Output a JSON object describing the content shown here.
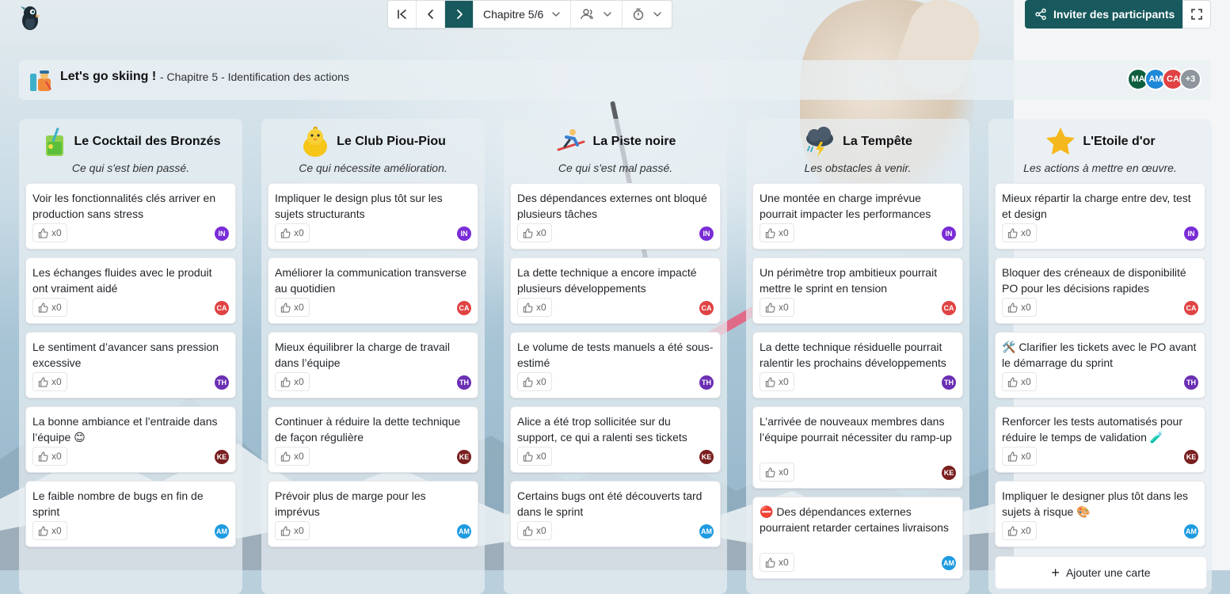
{
  "toolbar": {
    "chapter_label": "Chapitre 5/6"
  },
  "invite_label": "Inviter des participants",
  "header": {
    "title": "Let's go skiing !",
    "subtitle": "- Chapitre 5 - Identification des actions"
  },
  "participants": [
    {
      "initials": "MA",
      "color": "#0f5f3f"
    },
    {
      "initials": "AM",
      "color": "#1e88d8"
    },
    {
      "initials": "CA",
      "color": "#e04343"
    },
    {
      "initials": "+3",
      "color": "#8e959c"
    }
  ],
  "authors": {
    "IN": "#7a2dd6",
    "CA": "#e04343",
    "TH": "#6b2fb3",
    "KE": "#7a1f1f",
    "AM": "#1e9be0"
  },
  "columns": [
    {
      "title": "Le Cocktail des Bronzés",
      "subtitle": "Ce qui s'est bien passé.",
      "cards": [
        {
          "text": "Voir les fonctionnalités clés arriver en production sans stress",
          "likes": "x0",
          "author": "IN"
        },
        {
          "text": "Les échanges fluides avec le produit ont vraiment aidé",
          "likes": "x0",
          "author": "CA"
        },
        {
          "text": "Le sentiment d’avancer sans pression excessive",
          "likes": "x0",
          "author": "TH"
        },
        {
          "text": "La bonne ambiance et l’entraide dans l’équipe 😊",
          "likes": "x0",
          "author": "KE"
        },
        {
          "text": "Le faible nombre de bugs en fin de sprint",
          "likes": "x0",
          "author": "AM"
        }
      ]
    },
    {
      "title": "Le Club Piou-Piou",
      "subtitle": "Ce qui nécessite amélioration.",
      "cards": [
        {
          "text": "Impliquer le design plus tôt sur les sujets structurants",
          "likes": "x0",
          "author": "IN"
        },
        {
          "text": "Améliorer la communication transverse au quotidien",
          "likes": "x0",
          "author": "CA"
        },
        {
          "text": "Mieux équilibrer la charge de travail dans l’équipe",
          "likes": "x0",
          "author": "TH"
        },
        {
          "text": "Continuer à réduire la dette technique de façon régulière",
          "likes": "x0",
          "author": "KE"
        },
        {
          "text": "Prévoir plus de marge pour les imprévus",
          "likes": "x0",
          "author": "AM"
        }
      ]
    },
    {
      "title": "La Piste noire",
      "subtitle": "Ce qui s'est mal passé.",
      "cards": [
        {
          "text": "Des dépendances externes ont bloqué plusieurs tâches",
          "likes": "x0",
          "author": "IN"
        },
        {
          "text": "La dette technique a encore impacté plusieurs développements",
          "likes": "x0",
          "author": "CA"
        },
        {
          "text": "Le volume de tests manuels a été sous-estimé",
          "likes": "x0",
          "author": "TH"
        },
        {
          "text": "Alice a été trop sollicitée sur du support, ce qui a ralenti ses tickets",
          "likes": "x0",
          "author": "KE"
        },
        {
          "text": "Certains bugs ont été découverts tard dans le sprint",
          "likes": "x0",
          "author": "AM"
        }
      ]
    },
    {
      "title": "La Tempête",
      "subtitle": "Les obstacles à venir.",
      "cards": [
        {
          "text": "Une montée en charge imprévue pourrait impacter les performances",
          "likes": "x0",
          "author": "IN"
        },
        {
          "text": "Un périmètre trop ambitieux pourrait mettre le sprint en tension",
          "likes": "x0",
          "author": "CA"
        },
        {
          "text": "La dette technique résiduelle pourrait ralentir les prochains développements",
          "likes": "x0",
          "author": "TH"
        },
        {
          "text": "L’arrivée de nouveaux membres dans l’équipe pourrait nécessiter du ramp-up",
          "likes": "x0",
          "author": "KE"
        },
        {
          "text": "⛔ Des dépendances externes pourraient retarder certaines livraisons",
          "likes": "x0",
          "author": "AM"
        }
      ]
    },
    {
      "title": "L'Etoile d'or",
      "subtitle": "Les actions à mettre en œuvre.",
      "cards": [
        {
          "text": "Mieux répartir la charge entre dev, test et design",
          "likes": "x0",
          "author": "IN"
        },
        {
          "text": "Bloquer des créneaux de disponibilité PO pour les décisions rapides",
          "likes": "x0",
          "author": "CA"
        },
        {
          "text": "🛠️ Clarifier les tickets avec le PO avant le démarrage du sprint",
          "likes": "x0",
          "author": "TH"
        },
        {
          "text": "Renforcer les tests automatisés pour réduire le temps de validation 🧪",
          "likes": "x0",
          "author": "KE"
        },
        {
          "text": "Impliquer le designer plus tôt dans les sujets à risque 🎨",
          "likes": "x0",
          "author": "AM"
        }
      ],
      "add_card_label": "Ajouter une carte"
    }
  ],
  "icons": {
    "logo": "penguin-logo-icon",
    "first": "skip-first-icon",
    "prev": "chevron-left-icon",
    "next": "chevron-right-icon",
    "participants": "users-icon",
    "timer": "timer-icon",
    "share": "share-icon",
    "fullscreen": "fullscreen-icon",
    "like": "thumbs-up-icon"
  }
}
